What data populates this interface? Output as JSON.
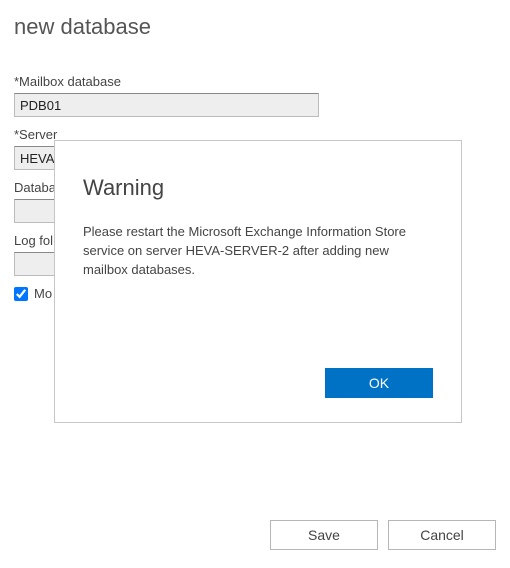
{
  "page": {
    "title": "new database"
  },
  "fields": {
    "mailbox_database": {
      "label": "*Mailbox database",
      "value": "PDB01"
    },
    "server": {
      "label": "*Server",
      "value": "HEVA-"
    },
    "db_path": {
      "label": "Databa",
      "value": ""
    },
    "log_folder": {
      "label": "Log fol",
      "value": ""
    },
    "mount_checkbox": {
      "label": "Mo",
      "checked": true
    }
  },
  "dialog": {
    "title": "Warning",
    "message": "Please restart the Microsoft Exchange Information Store service on server HEVA-SERVER-2 after adding new mailbox databases.",
    "ok": "OK"
  },
  "footer": {
    "save": "Save",
    "cancel": "Cancel"
  }
}
